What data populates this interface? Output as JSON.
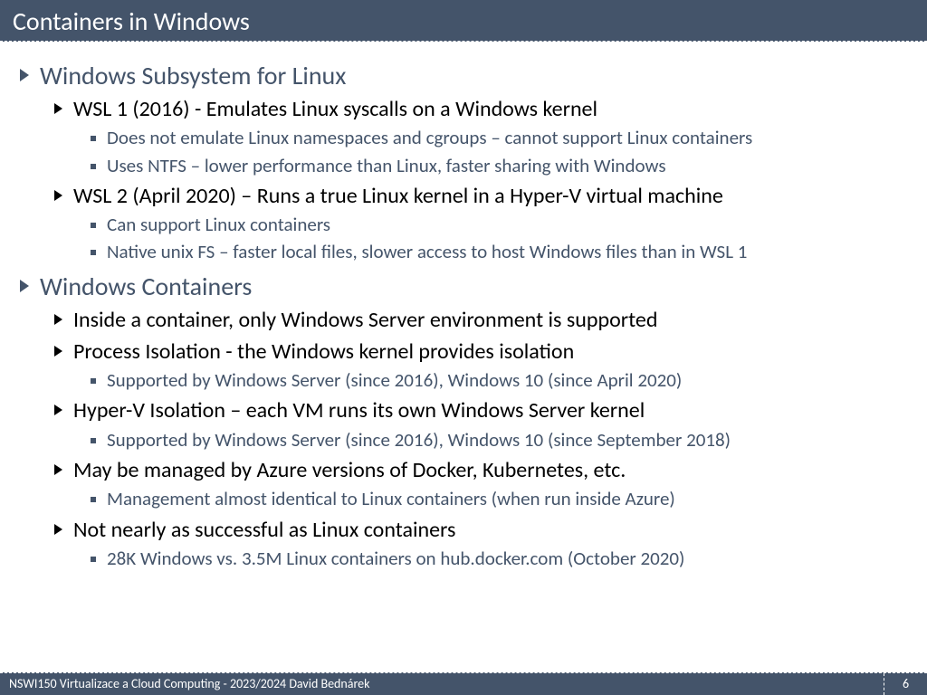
{
  "title": "Containers in Windows",
  "footer": {
    "left": "NSWI150 Virtualizace a Cloud Computing - 2023/2024 David Bednárek",
    "page": "6"
  },
  "s0": {
    "h": "Windows Subsystem for Linux",
    "a": {
      "h": "WSL 1 (2016) - Emulates Linux syscalls on a Windows kernel",
      "p1": "Does not emulate Linux namespaces and cgroups – cannot support Linux containers",
      "p2": "Uses NTFS – lower performance than Linux, faster sharing with Windows"
    },
    "b": {
      "h": "WSL 2 (April 2020) – Runs a true Linux kernel in a Hyper-V virtual machine",
      "p1": "Can support Linux containers",
      "p2": "Native unix FS – faster local files, slower access to host Windows files than in WSL 1"
    }
  },
  "s1": {
    "h": "Windows Containers",
    "a": {
      "h": "Inside a container, only Windows Server environment is supported"
    },
    "b": {
      "h": "Process Isolation - the Windows kernel provides isolation",
      "p1": "Supported by Windows Server (since 2016), Windows 10 (since April 2020)"
    },
    "c": {
      "h": "Hyper-V Isolation – each VM runs its own Windows Server kernel",
      "p1": "Supported by Windows Server (since 2016), Windows 10 (since September 2018)"
    },
    "d": {
      "h": "May be managed by Azure versions of Docker, Kubernetes, etc.",
      "p1": "Management almost identical to Linux containers (when run inside Azure)"
    },
    "e": {
      "h": "Not nearly as successful as Linux containers",
      "p1": "28K Windows vs. 3.5M Linux containers on hub.docker.com (October 2020)"
    }
  }
}
